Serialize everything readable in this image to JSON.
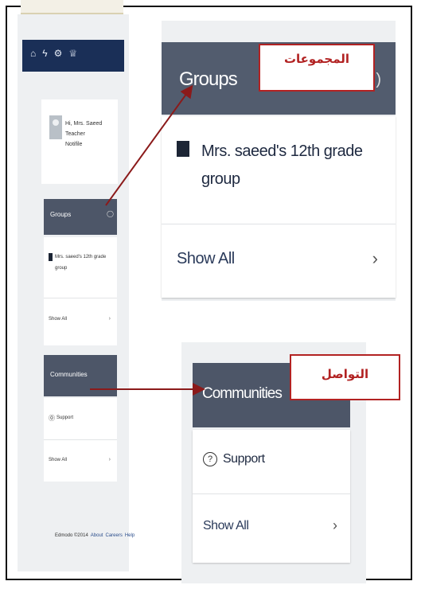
{
  "mini": {
    "header_icons": [
      "home-icon",
      "activity-icon",
      "settings-icon",
      "bell-icon"
    ],
    "profile": {
      "line1": "Hi, Mrs. Saeed",
      "line2": "Teacher",
      "line3": "Notifile"
    },
    "groups": {
      "title": "Groups",
      "item": "Mrs. saeed's 12th grade group",
      "show_all": "Show All"
    },
    "communities": {
      "title": "Communities",
      "item": "Support",
      "show_all": "Show All"
    },
    "footer": [
      "Edmodo ©2014",
      "About",
      "Careers",
      "Help"
    ]
  },
  "groups": {
    "title": "Groups",
    "item": "Mrs. saeed's 12th grade group",
    "show_all": "Show All",
    "label_ar": "المجموعات"
  },
  "communities": {
    "title": "Communities",
    "item": "Support",
    "show_all": "Show All",
    "label_ar": "التواصل"
  },
  "colors": {
    "annotation": "#b22222",
    "header_dark": "#1a2f57",
    "panel_head": "#4d5668"
  }
}
